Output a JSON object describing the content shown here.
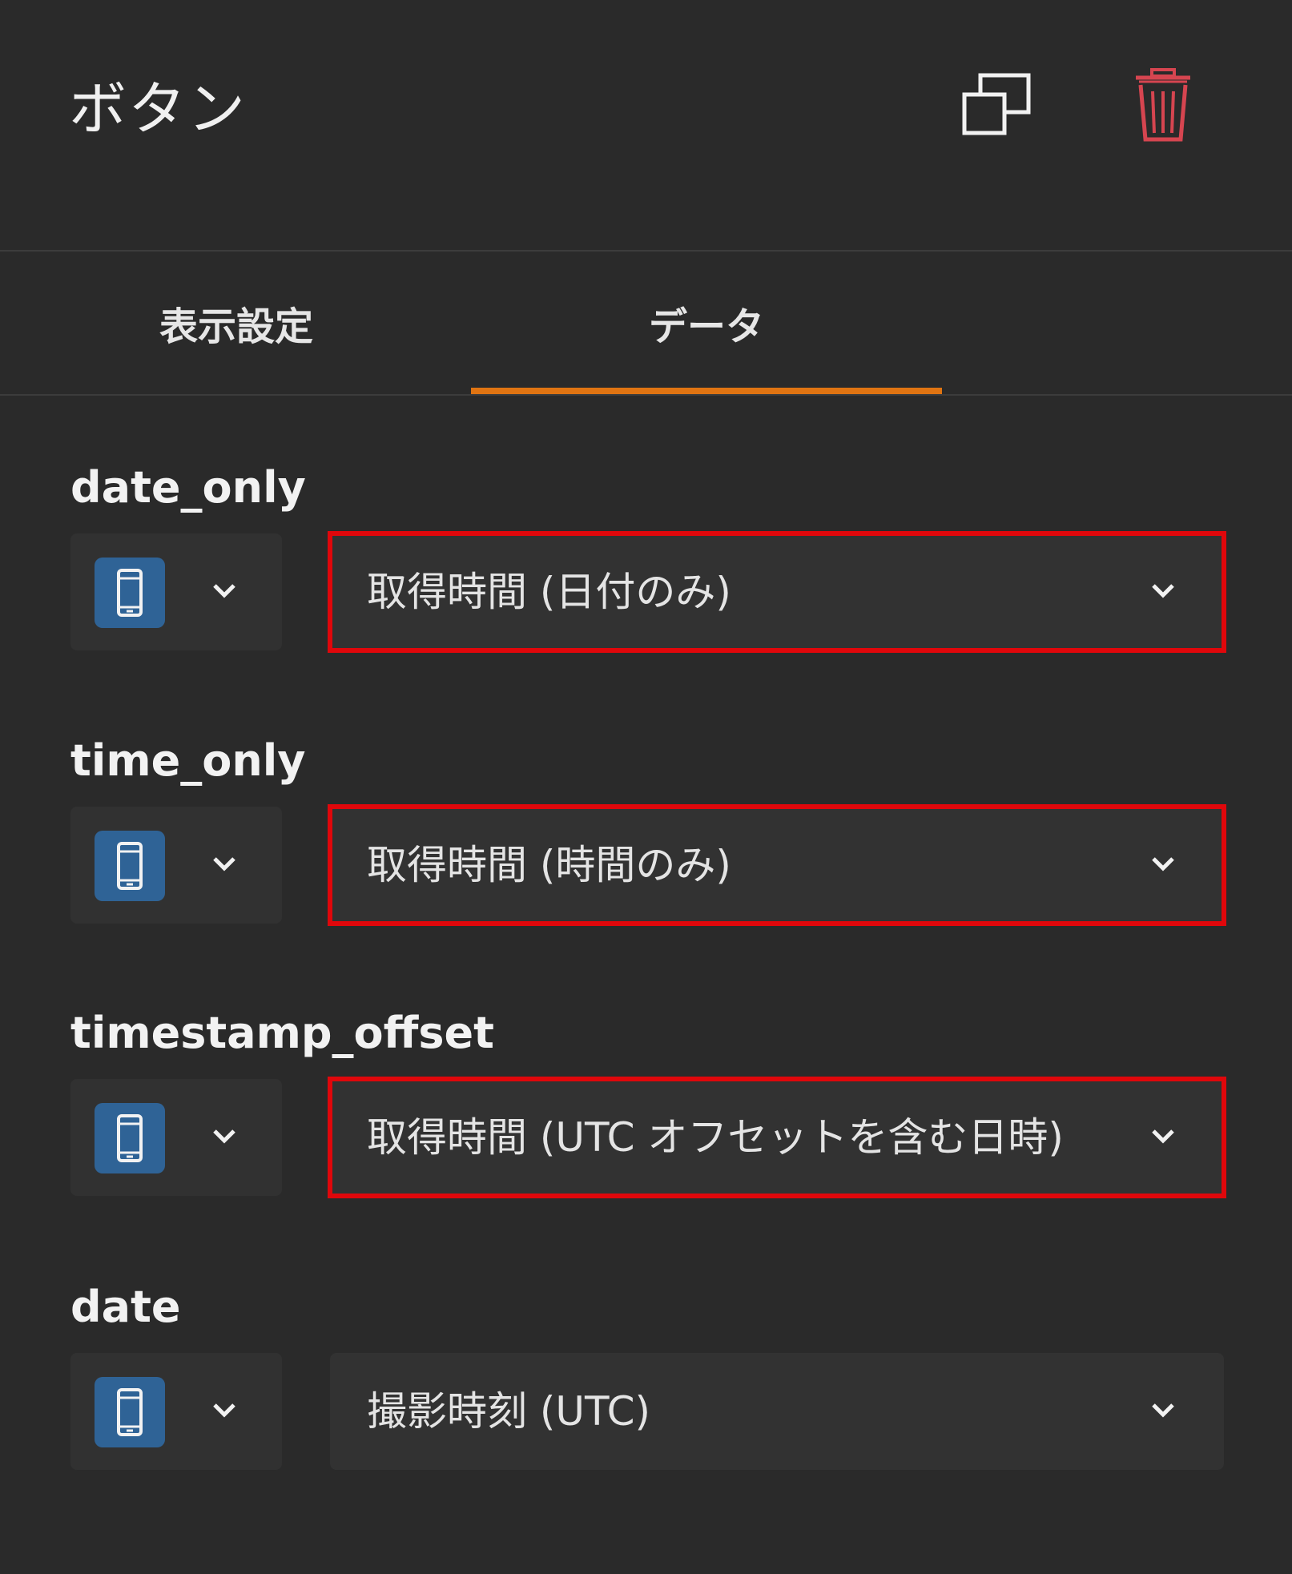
{
  "header": {
    "title": "ボタン",
    "duplicate_icon": "duplicate-icon",
    "delete_icon": "trash-icon",
    "delete_color": "#d64550"
  },
  "tabs": [
    {
      "label": "表示設定",
      "selected": false
    },
    {
      "label": "データ",
      "selected": true
    }
  ],
  "accent_color": "#e07412",
  "highlight_color": "#e0070b",
  "fields": [
    {
      "label": "date_only",
      "device_icon": "mobile-phone-icon",
      "value": "取得時間 (日付のみ)",
      "highlighted": true
    },
    {
      "label": "time_only",
      "device_icon": "mobile-phone-icon",
      "value": "取得時間 (時間のみ)",
      "highlighted": true
    },
    {
      "label": "timestamp_offset",
      "device_icon": "mobile-phone-icon",
      "value": "取得時間 (UTC オフセットを含む日時)",
      "highlighted": true
    },
    {
      "label": "date",
      "device_icon": "mobile-phone-icon",
      "value": "撮影時刻 (UTC)",
      "highlighted": false
    }
  ]
}
